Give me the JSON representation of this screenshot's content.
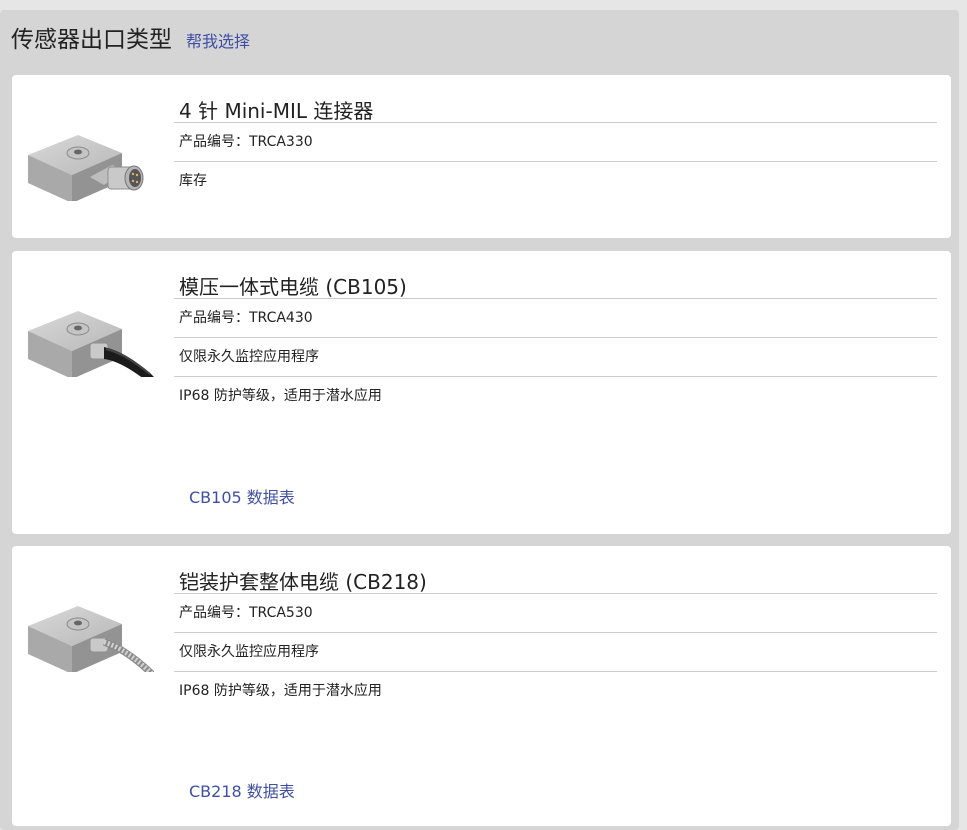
{
  "header": {
    "title": "传感器出口类型",
    "help_link": "帮我选择"
  },
  "products": [
    {
      "title": "4 针 Mini-MIL 连接器",
      "part_number": "产品编号：TRCA330",
      "details": [
        "库存"
      ],
      "cable": "connector"
    },
    {
      "title": "模压一体式电缆 (CB105)",
      "part_number": "产品编号：TRCA430",
      "details": [
        "仅限永久监控应用程序",
        "IP68 防护等级，适用于潜水应用"
      ],
      "datasheet_link": "CB105 数据表",
      "cable": "molded"
    },
    {
      "title": "铠装护套整体电缆 (CB218)",
      "part_number": "产品编号：TRCA530",
      "details": [
        "仅限永久监控应用程序",
        "IP68 防护等级，适用于潜水应用"
      ],
      "datasheet_link": "CB218 数据表",
      "cable": "armored"
    }
  ]
}
